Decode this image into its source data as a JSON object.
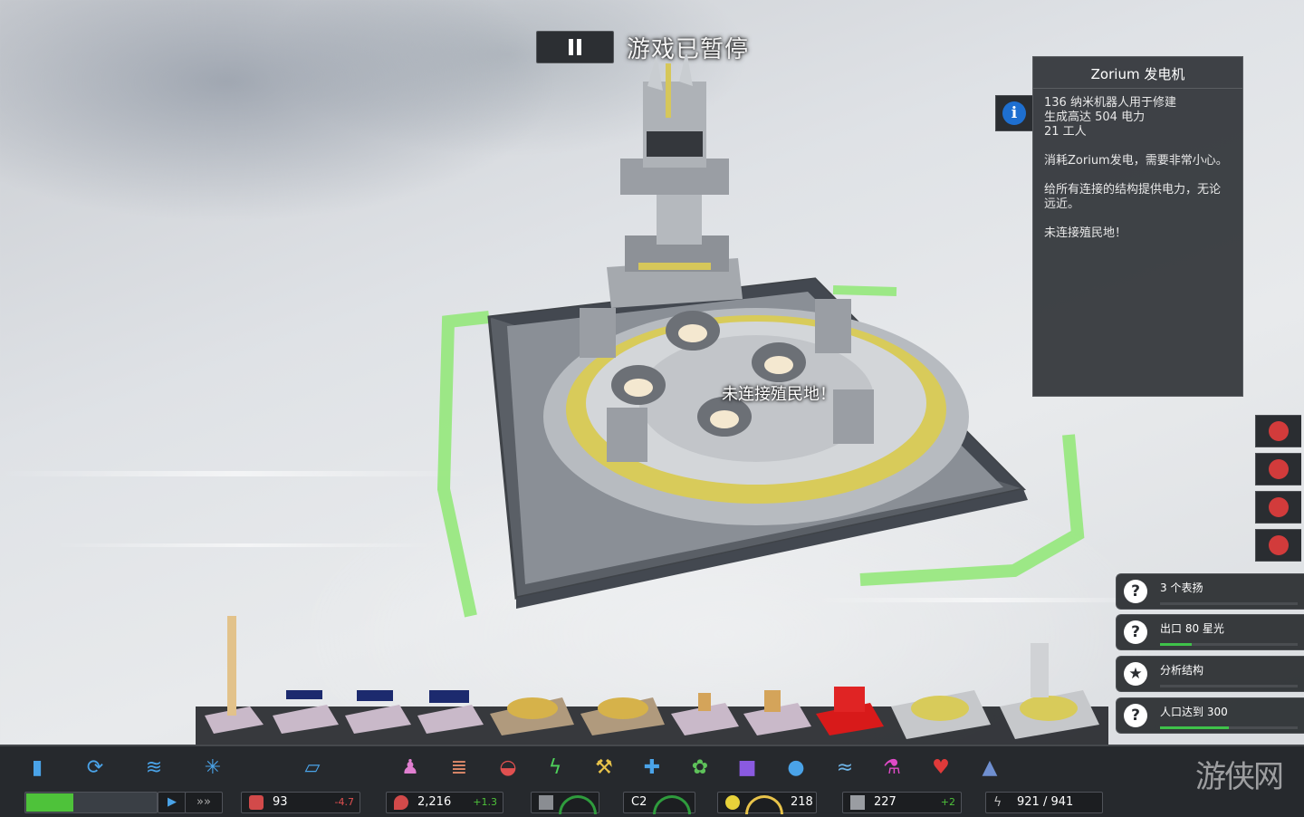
{
  "status": {
    "pause_text": "游戏已暂停"
  },
  "building": {
    "overlay_label": "未连接殖民地！"
  },
  "info_panel": {
    "title": "Zorium 发电机",
    "lines": [
      "136 纳米机器人用于修建",
      "生成高达 504 电力",
      "21 工人"
    ],
    "description": "消耗Zorium发电，需要非常小心。",
    "description2": "给所有连接的结构提供电力，无论远近。",
    "warning": "未连接殖民地！"
  },
  "objectives": [
    {
      "label": "3 个表扬",
      "icon": "question-icon",
      "progress": 0
    },
    {
      "label": "出口 80 星光",
      "icon": "question-icon",
      "progress": 0.23
    },
    {
      "label": "分析结构",
      "icon": "star-icon",
      "progress": 0
    },
    {
      "label": "人口达到 300",
      "icon": "question-icon",
      "progress": 0.5
    }
  ],
  "side_buttons": [
    "skull-alert-icon",
    "gift-icon",
    "flood-alert-icon",
    "apple-alert-icon"
  ],
  "categories": [
    "stats-icon",
    "cycle-icon",
    "layers-icon",
    "network-icon",
    "bridge-icon",
    "people-icon",
    "housing-icon",
    "food-icon",
    "power-icon",
    "industry-icon",
    "health-icon",
    "farm-icon",
    "cube-icon",
    "water-icon",
    "air-icon",
    "science-icon",
    "heart-icon",
    "monument-icon"
  ],
  "resources": {
    "food": {
      "value": "93",
      "delta": "-4.7"
    },
    "water": {
      "value": "2,216",
      "delta": "+1.3"
    },
    "workers": {
      "value": "227",
      "delta": "+2"
    },
    "happiness": {
      "value": "218"
    },
    "co2": {
      "label": "C2"
    },
    "power": {
      "value": "921 / 941"
    }
  },
  "watermark": "游侠网",
  "colors": {
    "accent_green": "#3fc24a",
    "accent_red": "#d23b3b",
    "info_blue": "#1e6fd0",
    "panel": "#323539"
  }
}
